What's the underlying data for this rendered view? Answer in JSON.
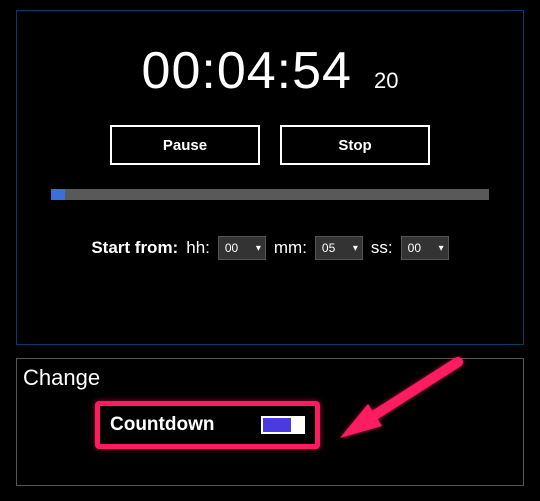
{
  "timer": {
    "main_time": "00:04:54",
    "sub_time": "20",
    "buttons": {
      "pause": "Pause",
      "stop": "Stop"
    },
    "progress_percent": 3.3,
    "start_from": {
      "label": "Start from:",
      "hh_label": "hh:",
      "hh_value": "00",
      "mm_label": "mm:",
      "mm_value": "05",
      "ss_label": "ss:",
      "ss_value": "00"
    }
  },
  "change": {
    "title": "Change",
    "countdown_label": "Countdown",
    "countdown_on": true
  },
  "colors": {
    "highlight": "#ff1a61",
    "toggle_on": "#4a3ae0",
    "progress": "#3a6fdc",
    "panel_border": "#0a3a6a"
  }
}
